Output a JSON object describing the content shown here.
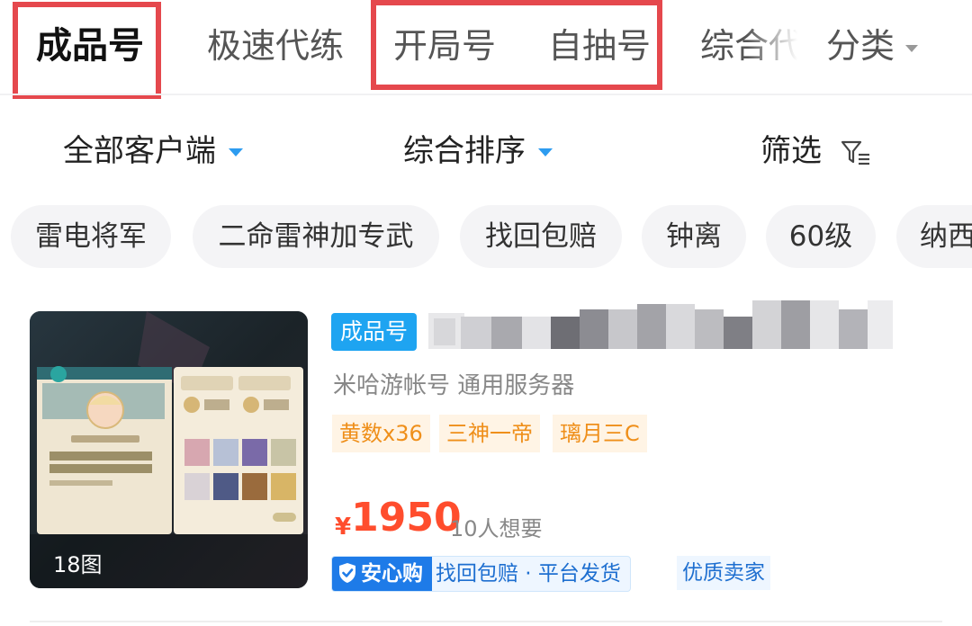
{
  "tabs": [
    {
      "label": "成品号",
      "active": true
    },
    {
      "label": "极速代练",
      "active": false
    },
    {
      "label": "开局号",
      "active": false
    },
    {
      "label": "自抽号",
      "active": false
    },
    {
      "label": "综合代",
      "active": false
    }
  ],
  "category_menu": {
    "label": "分类",
    "icon": "chevron-down-icon"
  },
  "filters": {
    "client": "全部客户端",
    "sort": "综合排序",
    "filter": "筛选",
    "filter_icon": "funnel-icon"
  },
  "chips": [
    "雷电将军",
    "二命雷神加专武",
    "找回包赔",
    "钟离",
    "60级",
    "纳西"
  ],
  "product": {
    "image_count": "18图",
    "type_tag": "成品号",
    "subtitle": "米哈游帐号  通用服务器",
    "tags": [
      "黄数x36",
      "三神一帝",
      "璃月三C"
    ],
    "currency": "¥",
    "price": "1950",
    "wants": "10人想要",
    "trust_badge": "安心购",
    "trust_text": "找回包赔 · 平台发货",
    "seller_badge": "优质卖家"
  },
  "colors": {
    "highlight_border": "#e5484d",
    "accent_blue": "#2d9cf0",
    "price_red": "#ff4d2d",
    "tag_orange": "#ef8f1a"
  }
}
